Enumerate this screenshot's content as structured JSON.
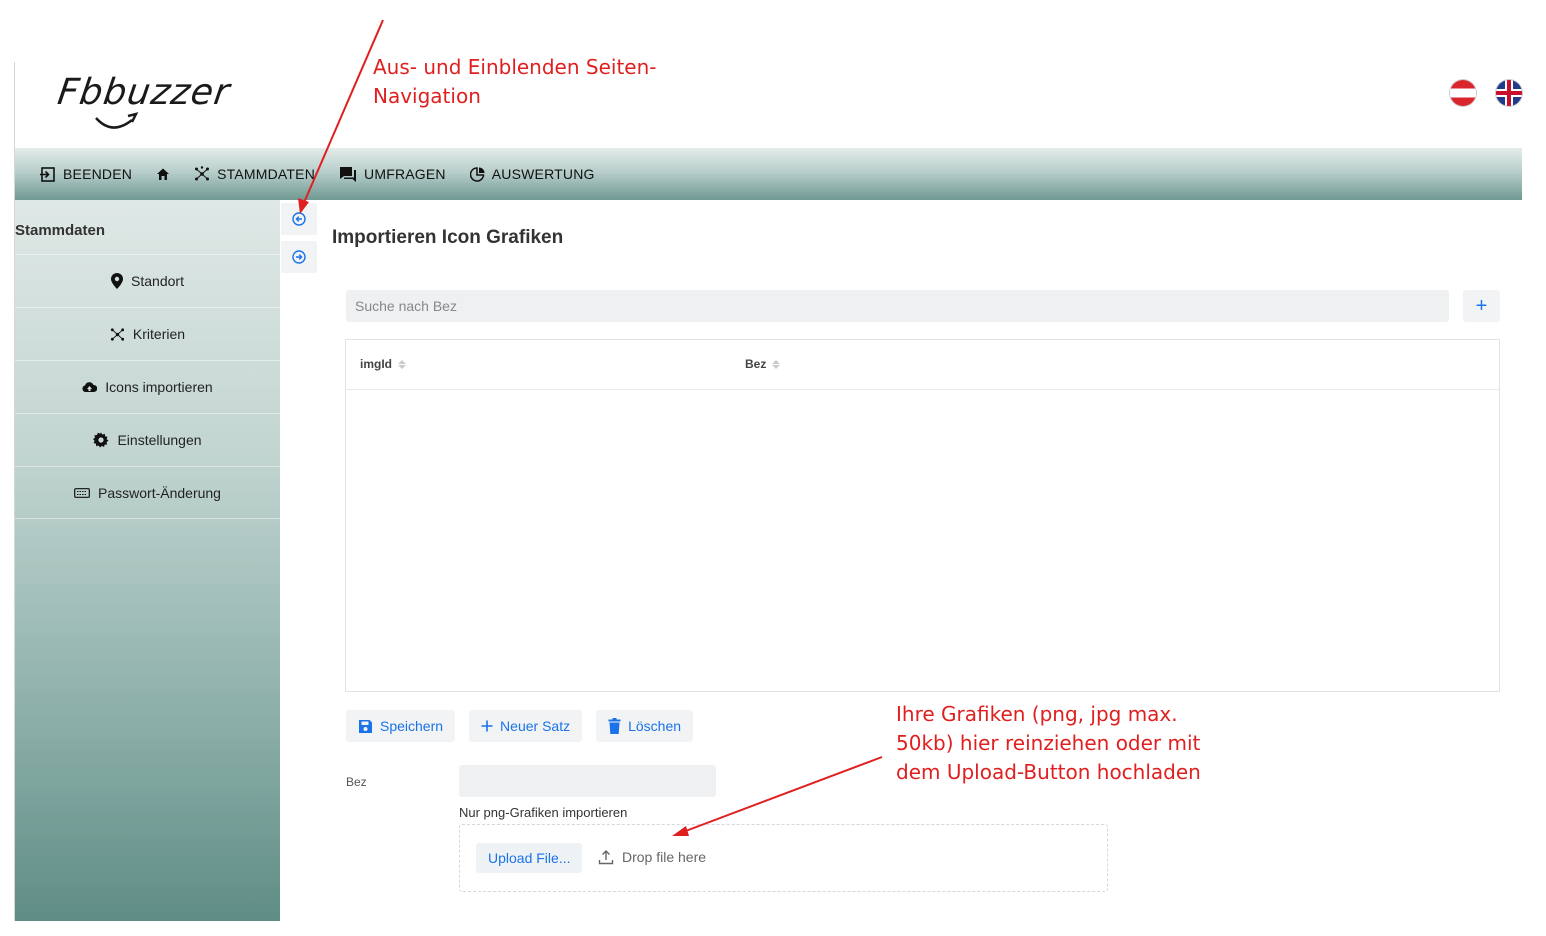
{
  "brand": {
    "logo_text": "Fbbuzzer"
  },
  "nav": {
    "items": [
      {
        "label": "BEENDEN",
        "icon": "exit-icon"
      },
      {
        "label": "",
        "icon": "home-icon"
      },
      {
        "label": "STAMMDATEN",
        "icon": "cluster-icon"
      },
      {
        "label": "UMFRAGEN",
        "icon": "chat-icon"
      },
      {
        "label": "AUSWERTUNG",
        "icon": "chart-icon"
      }
    ]
  },
  "languages": [
    {
      "code": "at",
      "icon": "austria-flag-icon"
    },
    {
      "code": "en",
      "icon": "uk-flag-icon"
    }
  ],
  "sidebar": {
    "title": "Stammdaten",
    "items": [
      {
        "label": "Standort",
        "icon": "map-pin-icon"
      },
      {
        "label": "Kriterien",
        "icon": "cluster-icon"
      },
      {
        "label": "Icons importieren",
        "icon": "upload-cloud-icon"
      },
      {
        "label": "Einstellungen",
        "icon": "gear-icon"
      },
      {
        "label": "Passwort-Änderung",
        "icon": "keyboard-icon"
      }
    ]
  },
  "main": {
    "title": "Importieren Icon Grafiken",
    "search_placeholder": "Suche nach Bez",
    "add_label": "+",
    "table": {
      "columns": [
        "imgId",
        "Bez"
      ],
      "rows": []
    },
    "buttons": {
      "save": "Speichern",
      "new": "Neuer Satz",
      "delete": "Löschen"
    },
    "form": {
      "bez_label": "Bez",
      "bez_value": "",
      "hint": "Nur png-Grafiken importieren",
      "upload_label": "Upload File...",
      "drop_label": "Drop file here"
    }
  },
  "annotations": {
    "nav_toggle": "Aus- und Einblenden Seiten-Navigation",
    "upload_hint": "Ihre Grafiken (png, jpg max. 50kb) hier reinziehen oder mit dem Upload-Button hochladen"
  },
  "colors": {
    "accent": "#1a73e8",
    "annotation": "#e02020",
    "nav_dark": "#6f9992"
  }
}
